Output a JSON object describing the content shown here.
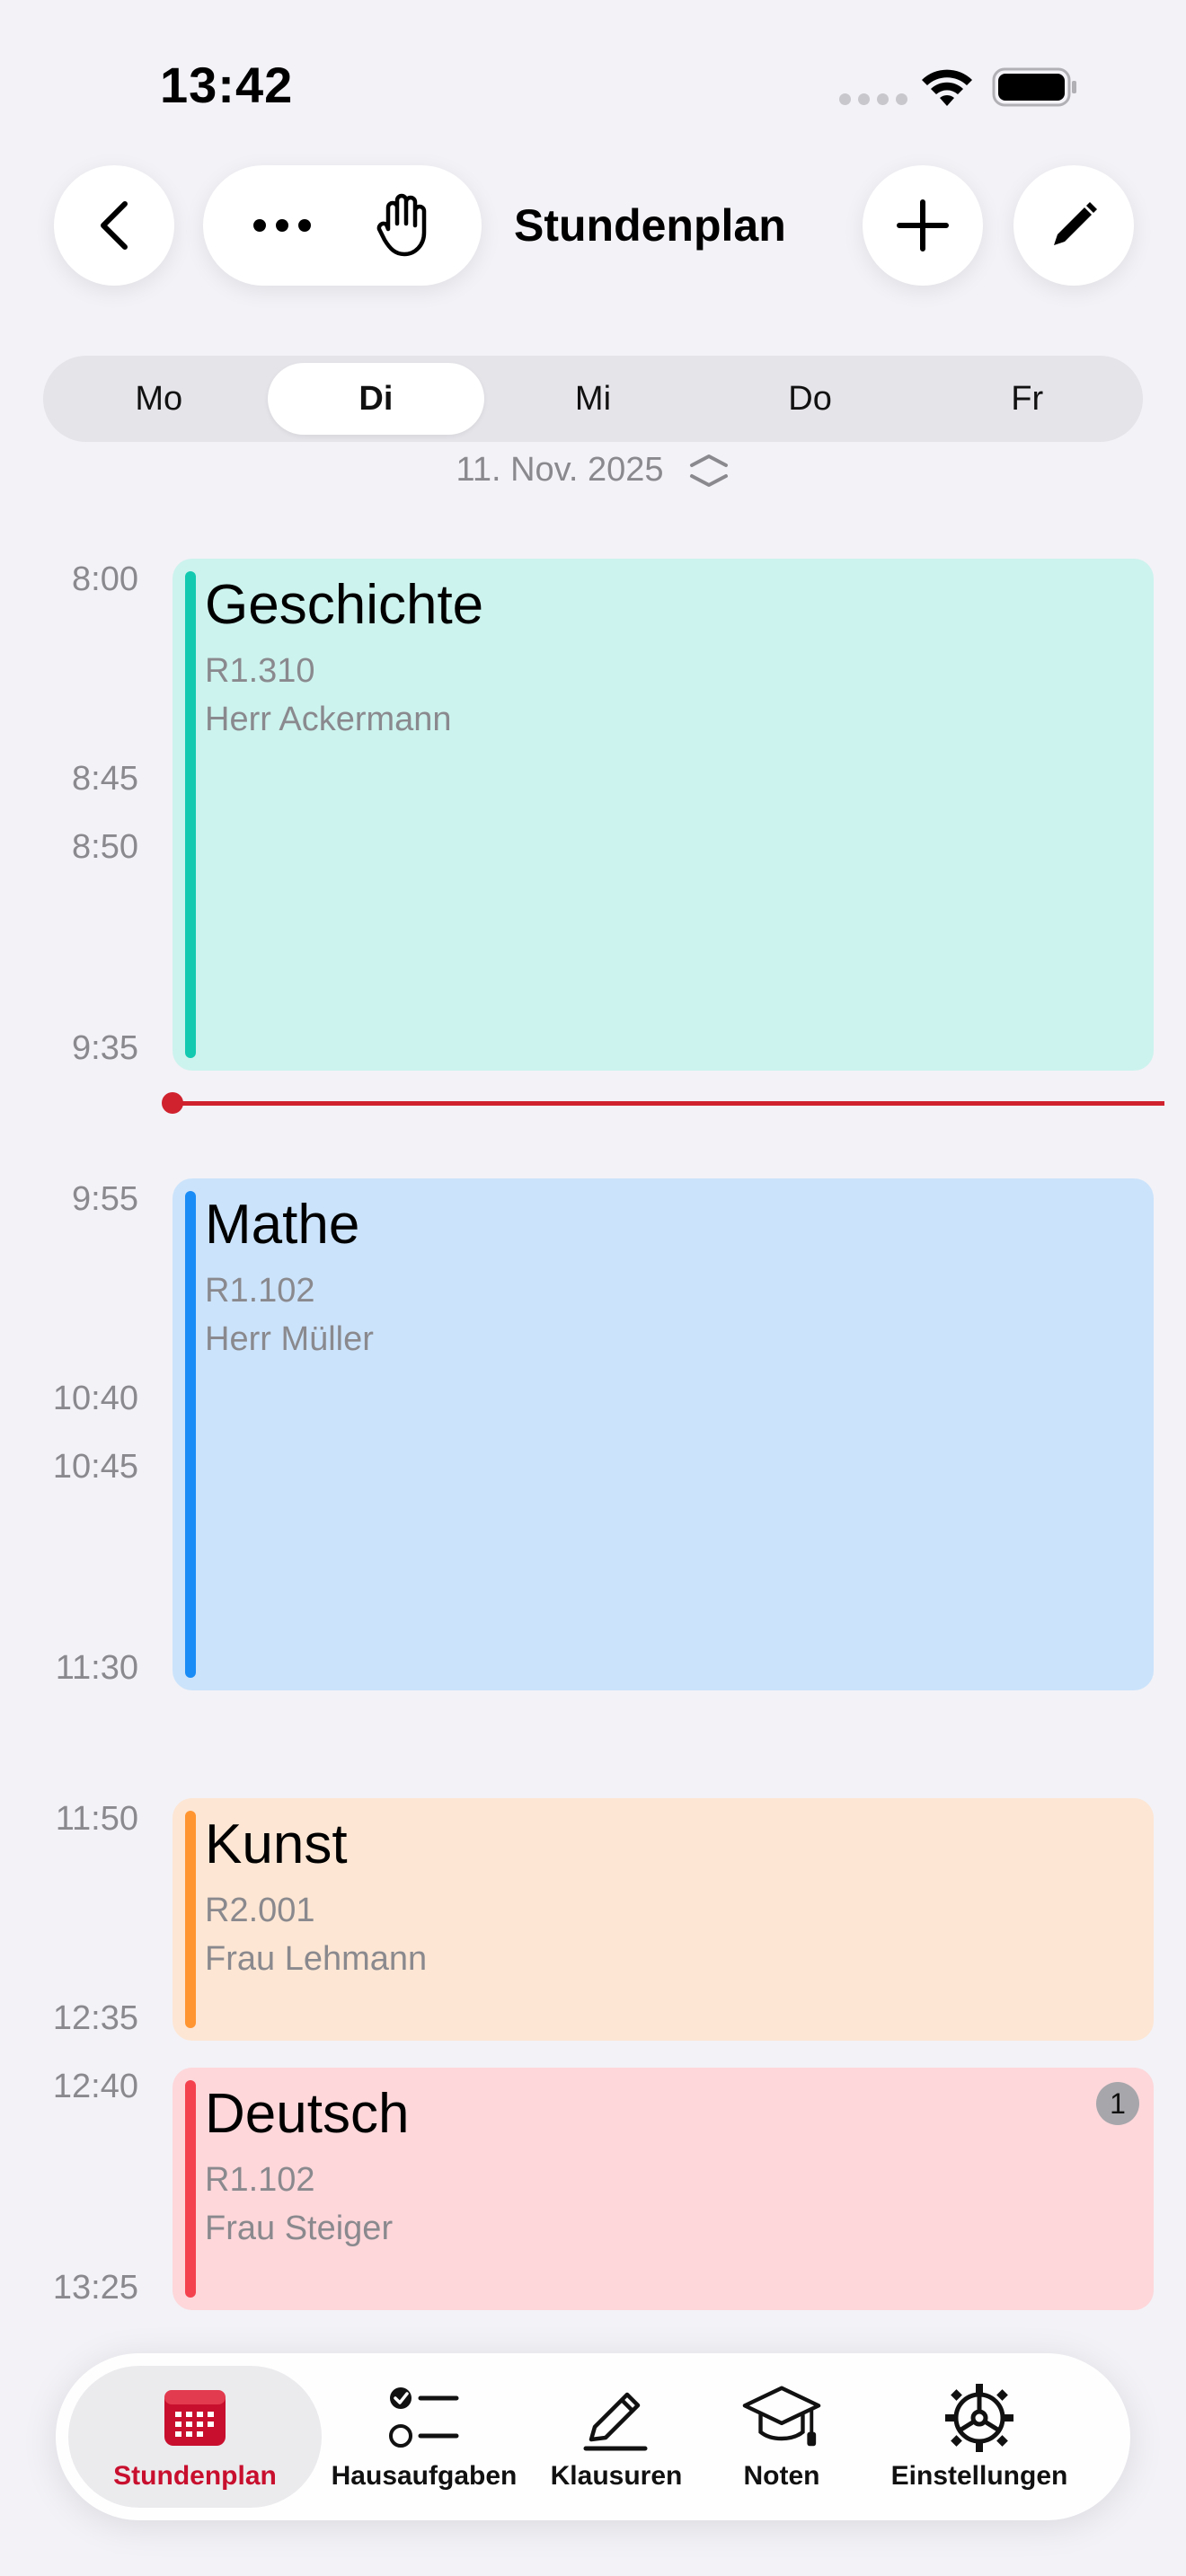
{
  "status": {
    "time": "13:42"
  },
  "nav": {
    "title": "Stundenplan"
  },
  "days": {
    "items": [
      "Mo",
      "Di",
      "Mi",
      "Do",
      "Fr"
    ],
    "selected": "Di"
  },
  "date": "11. Nov. 2025",
  "times": [
    "8:00",
    "8:45",
    "8:50",
    "9:35",
    "9:55",
    "10:40",
    "10:45",
    "11:30",
    "11:50",
    "12:35",
    "12:40",
    "13:25"
  ],
  "lessons": [
    {
      "subject": "Geschichte",
      "room": "R1.310",
      "teacher": "Herr Ackermann",
      "color": "#cdf3ee",
      "accent": "#13c9b0"
    },
    {
      "subject": "Mathe",
      "room": "R1.102",
      "teacher": "Herr Müller",
      "color": "#cce4fb",
      "accent": "#1a8cf5"
    },
    {
      "subject": "Kunst",
      "room": "R2.001",
      "teacher": "Frau Lehmann",
      "color": "#fde6d3",
      "accent": "#ff9531"
    },
    {
      "subject": "Deutsch",
      "room": "R1.102",
      "teacher": "Frau Steiger",
      "color": "#fdd7da",
      "accent": "#f5424f",
      "badge": "1"
    }
  ],
  "tabs": [
    {
      "label": "Stundenplan",
      "icon": "calendar-icon",
      "active": true
    },
    {
      "label": "Hausaufgaben",
      "icon": "checklist-icon"
    },
    {
      "label": "Klausuren",
      "icon": "pencil-icon"
    },
    {
      "label": "Noten",
      "icon": "graduation-cap-icon"
    },
    {
      "label": "Einstellungen",
      "icon": "gear-icon"
    }
  ],
  "colors": {
    "accent": "#c8102e",
    "now_line": "#d0212e"
  }
}
